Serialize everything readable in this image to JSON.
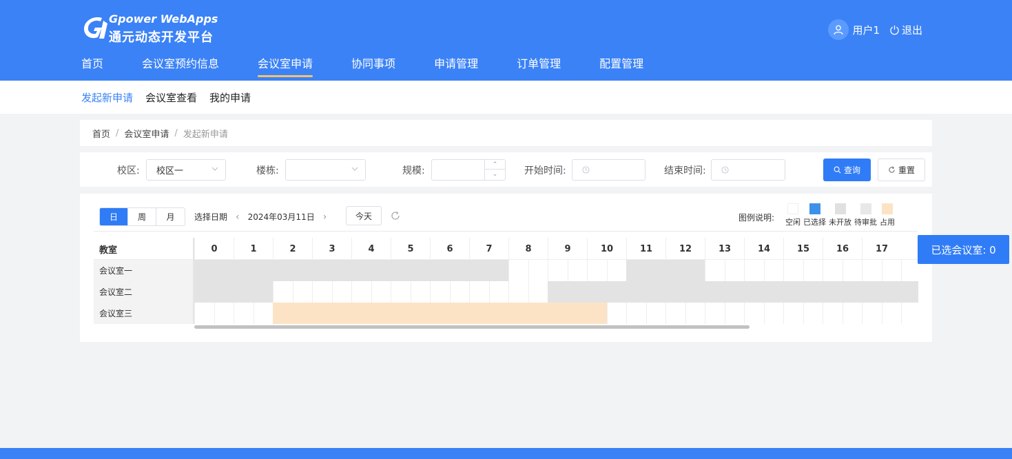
{
  "header": {
    "logo_en": "Gpower WebApps",
    "logo_cn": "通元动态开发平台",
    "user_name": "用户1",
    "logout_label": "退出",
    "nav": [
      {
        "label": "首页",
        "active": false
      },
      {
        "label": "会议室预约信息",
        "active": false
      },
      {
        "label": "会议室申请",
        "active": true
      },
      {
        "label": "协同事项",
        "active": false
      },
      {
        "label": "申请管理",
        "active": false
      },
      {
        "label": "订单管理",
        "active": false
      },
      {
        "label": "配置管理",
        "active": false
      }
    ]
  },
  "subnav": [
    {
      "label": "发起新申请",
      "active": true
    },
    {
      "label": "会议室查看",
      "active": false
    },
    {
      "label": "我的申请",
      "active": false
    }
  ],
  "breadcrumb": [
    "首页",
    "会议室申请",
    "发起新申请"
  ],
  "filters": {
    "campus_label": "校区:",
    "campus_value": "校区一",
    "building_label": "楼栋:",
    "building_value": "",
    "scale_label": "规模:",
    "scale_value": "",
    "start_label": "开始时间:",
    "end_label": "结束时间:",
    "query_label": "查询",
    "reset_label": "重置"
  },
  "schedule": {
    "view_modes": [
      {
        "label": "日",
        "active": true
      },
      {
        "label": "周",
        "active": false
      },
      {
        "label": "月",
        "active": false
      }
    ],
    "select_date_label": "选择日期",
    "current_date": "2024年03月11日",
    "today_label": "今天",
    "legend_title": "图例说明:",
    "legend": [
      {
        "label": "空闲",
        "color": "#ffffff"
      },
      {
        "label": "已选择",
        "color": "#3d92e8"
      },
      {
        "label": "未开放",
        "color": "#e0e0e0"
      },
      {
        "label": "待审批",
        "color": "#e8e8e8"
      },
      {
        "label": "占用",
        "color": "#fde3c6"
      }
    ],
    "room_header": "教室",
    "hours": [
      "0",
      "1",
      "2",
      "3",
      "4",
      "5",
      "6",
      "7",
      "8",
      "9",
      "10",
      "11",
      "12",
      "13",
      "14",
      "15",
      "16",
      "17"
    ],
    "rooms": [
      {
        "name": "会议室一",
        "blocks": [
          {
            "from": 0,
            "to": 16,
            "status": "closed"
          },
          {
            "from": 22,
            "to": 26,
            "status": "closed"
          }
        ]
      },
      {
        "name": "会议室二",
        "blocks": [
          {
            "from": 0,
            "to": 4,
            "status": "closed"
          },
          {
            "from": 18,
            "to": 37,
            "status": "closed"
          }
        ]
      },
      {
        "name": "会议室三",
        "blocks": [
          {
            "from": 4,
            "to": 21,
            "status": "occupied"
          }
        ]
      }
    ]
  },
  "selected_badge": "已选会议室: 0",
  "colors": {
    "primary": "#3b82f6",
    "button_primary": "#2f7cf6",
    "closed": "#e3e3e3",
    "occupied": "#fde3c6"
  }
}
